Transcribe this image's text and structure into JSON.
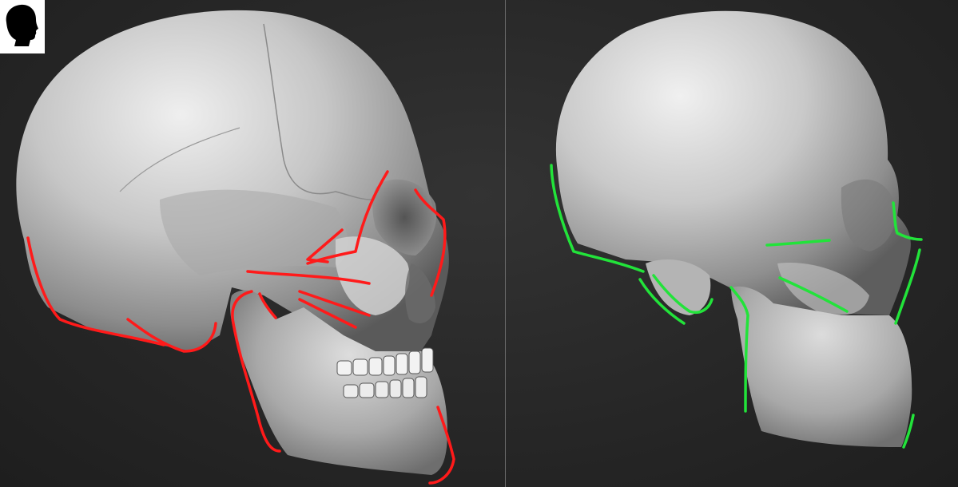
{
  "views": {
    "left": {
      "subject": "detailed-skull-sculpt",
      "annotation_color": "#ff1a1a"
    },
    "right": {
      "subject": "blocked-out-skull-sculpt",
      "annotation_color": "#22e33a"
    }
  },
  "logo": {
    "icon": "head-silhouette-icon",
    "background": "#ffffff",
    "foreground": "#000000"
  },
  "colors": {
    "background": "#2a2a2a",
    "divider": "#6a6a6a",
    "bone": "#bdbdbd"
  }
}
